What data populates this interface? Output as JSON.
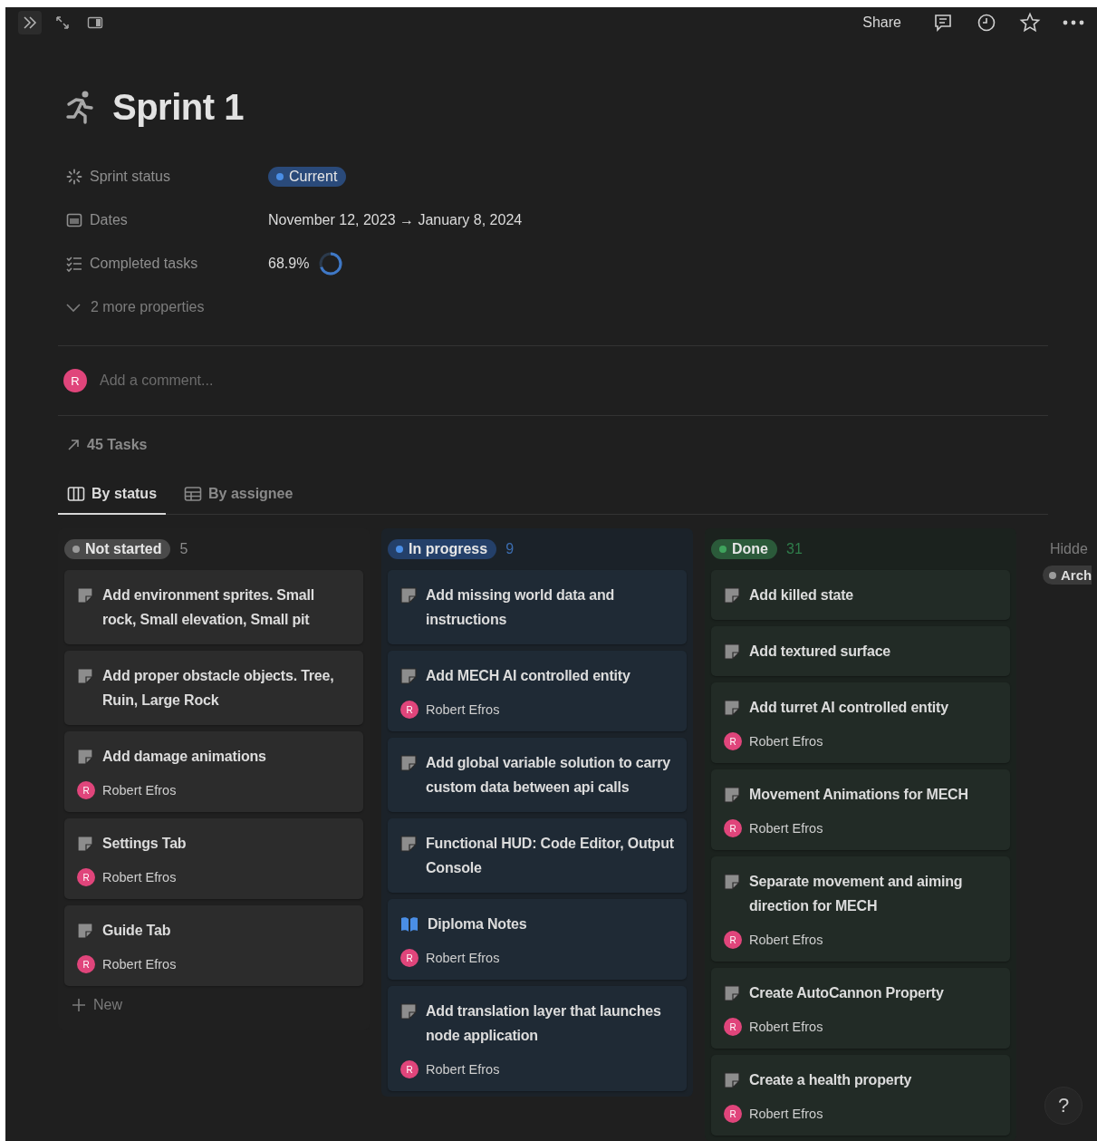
{
  "topbar": {
    "share": "Share"
  },
  "page": {
    "title": "Sprint 1",
    "properties": [
      {
        "kind": "status",
        "label": "Sprint status",
        "value": "Current",
        "color": "#4a8ee6"
      },
      {
        "kind": "date",
        "label": "Dates",
        "value": "November 12, 2023 → January 8, 2024"
      },
      {
        "kind": "progress",
        "label": "Completed tasks",
        "value": "68.9%"
      }
    ],
    "more_properties": "2 more properties",
    "comment": {
      "avatar": "R",
      "placeholder": "Add a comment..."
    },
    "linked": "45 Tasks"
  },
  "views": [
    {
      "label": "By status",
      "kind": "board",
      "selected": true
    },
    {
      "label": "By assignee",
      "kind": "table",
      "selected": false
    }
  ],
  "board": {
    "groups": [
      {
        "label": "Not started",
        "count": "5",
        "color": "#9b9b9b",
        "new": "New",
        "cards": [
          {
            "kind": "page",
            "title": "Add environment sprites. Small rock, Small elevation, Small pit"
          },
          {
            "kind": "page",
            "title": "Add proper obstacle objects. Tree, Ruin, Large Rock"
          },
          {
            "kind": "page",
            "title": "Add damage animations",
            "assignee": {
              "avatar": "R",
              "name": "Robert Efros"
            }
          },
          {
            "kind": "page",
            "title": "Settings Tab",
            "assignee": {
              "avatar": "R",
              "name": "Robert Efros"
            }
          },
          {
            "kind": "page",
            "title": "Guide Tab",
            "assignee": {
              "avatar": "R",
              "name": "Robert Efros"
            }
          }
        ]
      },
      {
        "label": "In progress",
        "count": "9",
        "color": "#4a8ee6",
        "cards": [
          {
            "kind": "page",
            "title": "Add missing world data and instructions"
          },
          {
            "kind": "page",
            "title": "Add MECH AI controlled entity",
            "assignee": {
              "avatar": "R",
              "name": "Robert Efros"
            }
          },
          {
            "kind": "page",
            "title": "Add global variable solution to carry custom data between api calls"
          },
          {
            "kind": "page",
            "title": "Functional HUD: Code Editor, Output Console"
          },
          {
            "kind": "book",
            "title": "Diploma Notes",
            "assignee": {
              "avatar": "R",
              "name": "Robert Efros"
            }
          },
          {
            "kind": "page",
            "title": "Add translation layer that launches node application",
            "assignee": {
              "avatar": "R",
              "name": "Robert Efros"
            }
          }
        ]
      },
      {
        "label": "Done",
        "count": "31",
        "color": "#3fa35d",
        "cards": [
          {
            "kind": "page",
            "title": "Add killed state"
          },
          {
            "kind": "page",
            "title": "Add textured surface"
          },
          {
            "kind": "page",
            "title": "Add turret AI controlled entity",
            "assignee": {
              "avatar": "R",
              "name": "Robert Efros"
            }
          },
          {
            "kind": "page",
            "title": "Movement Animations for MECH",
            "assignee": {
              "avatar": "R",
              "name": "Robert Efros"
            }
          },
          {
            "kind": "page",
            "title": "Separate movement and aiming direction for MECH",
            "assignee": {
              "avatar": "R",
              "name": "Robert Efros"
            }
          },
          {
            "kind": "page",
            "title": "Create AutoCannon Property",
            "assignee": {
              "avatar": "R",
              "name": "Robert Efros"
            }
          },
          {
            "kind": "page",
            "title": "Create a health property",
            "assignee": {
              "avatar": "R",
              "name": "Robert Efros"
            }
          }
        ]
      }
    ],
    "hidden": {
      "label": "Hidde",
      "groups": [
        {
          "label": "Arch",
          "color": "#9b9b9b"
        }
      ]
    }
  },
  "help": "?"
}
